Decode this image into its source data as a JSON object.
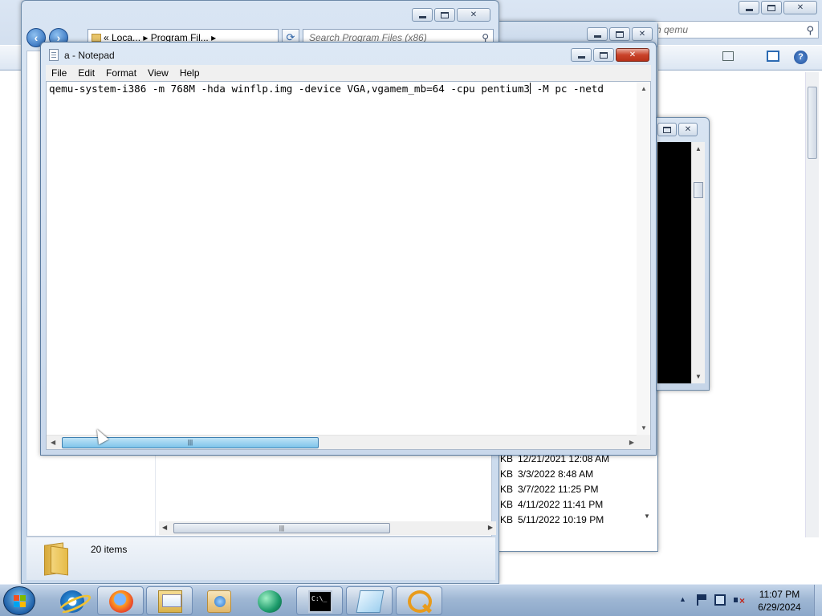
{
  "notepad": {
    "title": "a - Notepad",
    "menu": [
      "File",
      "Edit",
      "Format",
      "View",
      "Help"
    ],
    "content_before_caret": "qemu-system-i386 -m 768M -hda winflp.img -device VGA,vgamem_mb=64 -cpu pentium3",
    "content_after_caret": " -M pc -netd"
  },
  "explorer_left": {
    "address": "« Loca... ▸ Program Fil... ▸",
    "search_placeholder": "Search Program Files (x86)",
    "items_count": "20 items"
  },
  "explorer_max": {
    "search_text": "h qemu"
  },
  "file_list": {
    "rows": [
      {
        "size_unit": "KB",
        "date": "12/21/2021 12:08 AM"
      },
      {
        "size_unit": "KB",
        "date": "3/3/2022 8:48 AM"
      },
      {
        "size_unit": "KB",
        "date": "3/7/2022 11:25 PM"
      },
      {
        "size_unit": "KB",
        "date": "4/11/2022 11:41 PM"
      },
      {
        "size_unit": "KB",
        "date": "5/11/2022 10:19 PM"
      }
    ]
  },
  "taskbar": {
    "time": "11:07 PM",
    "date": "6/29/2024",
    "pinned": [
      "internet-explorer",
      "firefox",
      "windows-explorer",
      "media-player",
      "green-app",
      "command-prompt",
      "notepad",
      "search-tool"
    ]
  },
  "colors": {
    "accent": "#1e5fa8",
    "close_active": "#c9432a",
    "scroll_thumb_active": "#7ec4ea"
  }
}
